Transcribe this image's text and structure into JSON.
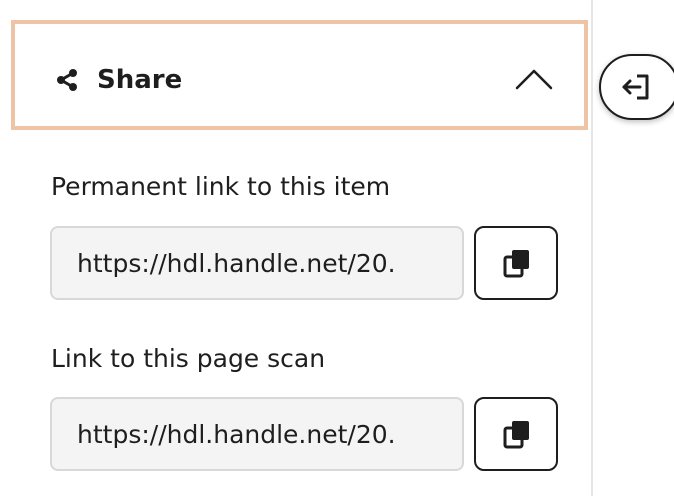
{
  "share": {
    "title": "Share",
    "icon": "share-icon",
    "expanded": true,
    "accent_border": "#efc4a6"
  },
  "exit_button": {
    "icon": "exit-icon"
  },
  "links": [
    {
      "label": "Permanent link to this item",
      "value": "https://hdl.handle.net/20.",
      "copy_icon": "copy-icon"
    },
    {
      "label": "Link to this page scan",
      "value": "https://hdl.handle.net/20.",
      "copy_icon": "copy-icon"
    }
  ]
}
